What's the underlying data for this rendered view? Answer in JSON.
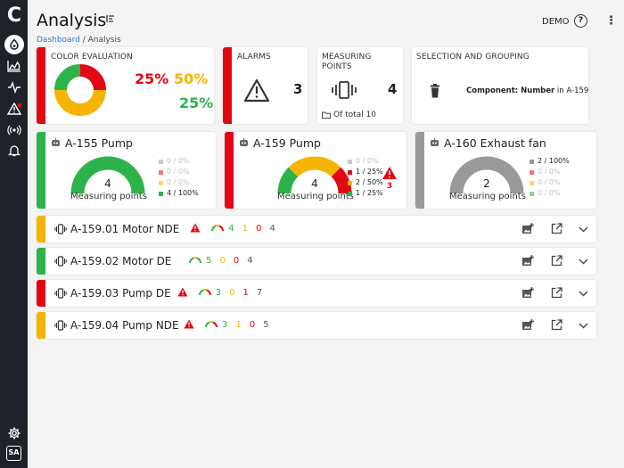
{
  "header": {
    "title": "Analysis",
    "user": "DEMO"
  },
  "breadcrumb": {
    "link": "Dashboard",
    "separator": " / ",
    "current": "Analysis"
  },
  "sidebar": {
    "user_initials": "SA"
  },
  "color_evaluation": {
    "label": "COLOR EVALUATION",
    "red": "25%",
    "orange": "50%",
    "green": "25%",
    "donut": [
      {
        "color": "#e30613",
        "value": 25
      },
      {
        "color": "#f5b400",
        "value": 50
      },
      {
        "color": "#2db34a",
        "value": 25
      }
    ]
  },
  "alarms": {
    "label": "ALARMS",
    "count": "3"
  },
  "measuring_points": {
    "label_line1": "MEASURING",
    "label_line2": "POINTS",
    "count": "4",
    "of_total": "Of total 10"
  },
  "selection": {
    "label": "SELECTION AND GROUPING",
    "key": "Component: Number",
    "suffix": " in A-159"
  },
  "equipment": [
    {
      "name": "A-155 Pump",
      "count": "4",
      "label": "Measuring points",
      "legend": [
        {
          "color": "#9a9a9a",
          "text": "0 / 0%",
          "dim": true
        },
        {
          "color": "#e30613",
          "text": "0 / 0%",
          "dim": true
        },
        {
          "color": "#f5b400",
          "text": "0 / 0%",
          "dim": true
        },
        {
          "color": "#2db34a",
          "text": "4 / 100%",
          "dim": false
        }
      ]
    },
    {
      "name": "A-159 Pump",
      "count": "4",
      "label": "Measuring points",
      "alarm_count": "3",
      "legend": [
        {
          "color": "#9a9a9a",
          "text": "0 / 0%",
          "dim": true
        },
        {
          "color": "#e30613",
          "text": "1 / 25%",
          "dim": false
        },
        {
          "color": "#f5b400",
          "text": "2 / 50%",
          "dim": false
        },
        {
          "color": "#2db34a",
          "text": "1 / 25%",
          "dim": false
        }
      ]
    },
    {
      "name": "A-160 Exhaust fan",
      "count": "2",
      "label": "Measuring points",
      "legend": [
        {
          "color": "#9a9a9a",
          "text": "2 / 100%",
          "dim": false
        },
        {
          "color": "#e30613",
          "text": "0 / 0%",
          "dim": true
        },
        {
          "color": "#f5b400",
          "text": "0 / 0%",
          "dim": true
        },
        {
          "color": "#2db34a",
          "text": "0 / 0%",
          "dim": true
        }
      ]
    }
  ],
  "rows": [
    {
      "title": "A-159.01 Motor NDE",
      "warn": true,
      "status_color": "#f5b400",
      "counts": [
        "4",
        "1",
        "0",
        "4"
      ]
    },
    {
      "title": "A-159.02 Motor DE",
      "warn": false,
      "status_color": "#2db34a",
      "counts": [
        "5",
        "0",
        "0",
        "4"
      ]
    },
    {
      "title": "A-159.03 Pump DE",
      "warn": true,
      "status_color": "#e30613",
      "counts": [
        "3",
        "0",
        "1",
        "7"
      ]
    },
    {
      "title": "A-159.04 Pump NDE",
      "warn": true,
      "status_color": "#f5b400",
      "counts": [
        "3",
        "1",
        "0",
        "5"
      ]
    }
  ]
}
